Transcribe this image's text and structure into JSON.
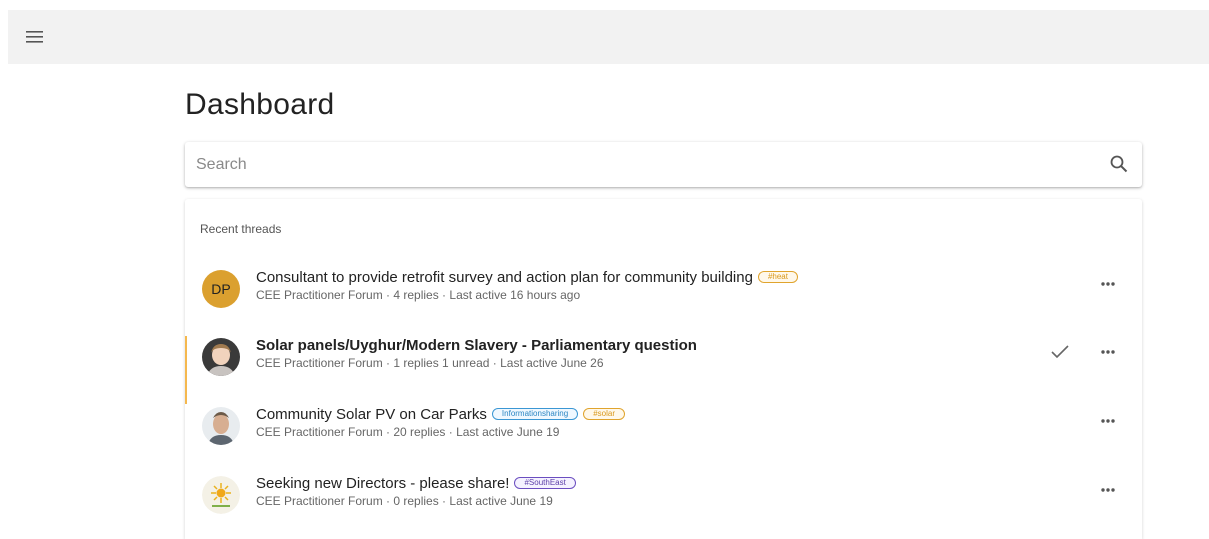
{
  "page": {
    "title": "Dashboard"
  },
  "search": {
    "placeholder": "Search"
  },
  "threads": {
    "section_label": "Recent threads",
    "items": [
      {
        "avatar_initials": "DP",
        "title": "Consultant to provide retrofit survey and action plan for community building",
        "tags": [
          "#heat"
        ],
        "meta": "CEE Practitioner Forum · 4 replies · Last active 16 hours ago"
      },
      {
        "title": "Solar panels/Uyghur/Modern Slavery - Parliamentary question",
        "tags": [],
        "meta": "CEE Practitioner Forum · 1 replies 1 unread · Last active June 26",
        "unread": true
      },
      {
        "title": "Community Solar PV on Car Parks",
        "tags": [
          "Informationsharing",
          "#solar"
        ],
        "meta": "CEE Practitioner Forum · 20 replies · Last active June 19"
      },
      {
        "title": "Seeking new Directors - please share!",
        "tags": [
          "#SouthEast"
        ],
        "meta": "CEE Practitioner Forum · 0 replies · Last active June 19"
      }
    ]
  },
  "colors": {
    "unread_accent": "#f5b84e",
    "avatar_dp": "#dba02f",
    "tag_heat": "#e0a42d",
    "tag_informationsharing": "#3b97d4",
    "tag_solar": "#e0a42d",
    "tag_southeast": "#6b4ec0"
  },
  "icons": {
    "menu": "hamburger-menu-icon",
    "search": "search-icon",
    "more": "more-horizontal-icon",
    "check": "check-icon"
  }
}
